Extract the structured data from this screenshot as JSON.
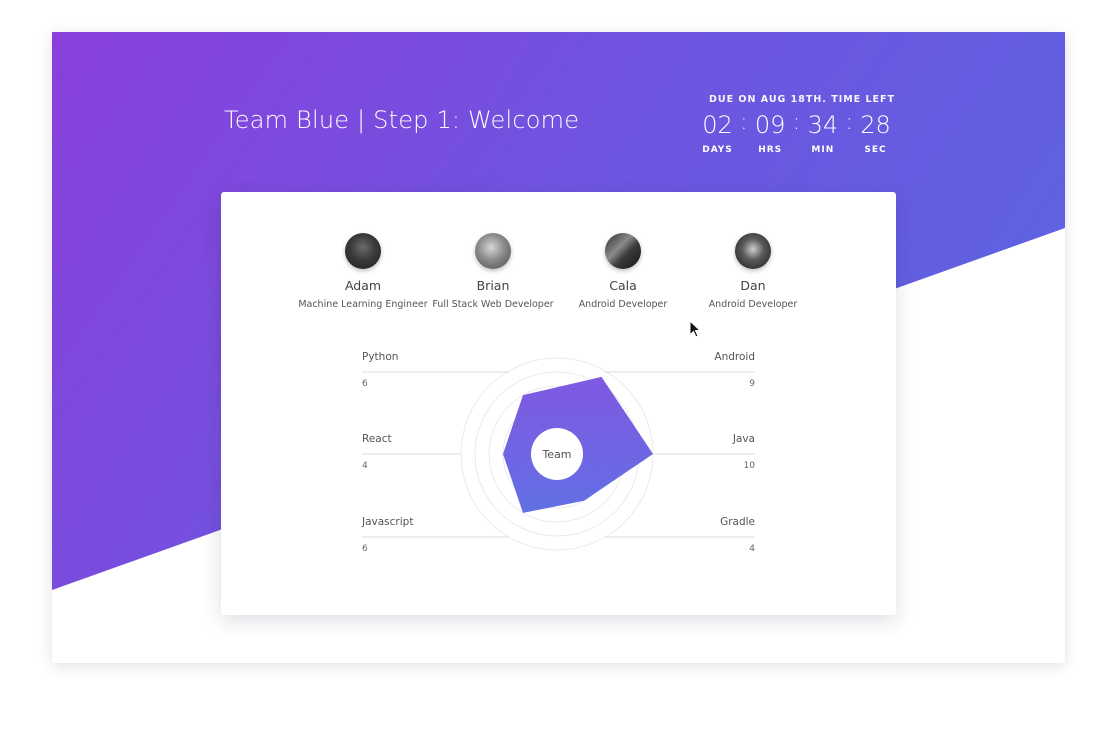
{
  "header": {
    "title": "Team Blue | Step 1: Welcome",
    "due_label": "DUE ON AUG 18TH. TIME LEFT",
    "countdown": [
      {
        "value": "02",
        "label": "DAYS"
      },
      {
        "value": "09",
        "label": "HRS"
      },
      {
        "value": "34",
        "label": "MIN"
      },
      {
        "value": "28",
        "label": "SEC"
      }
    ],
    "separator": ":"
  },
  "team": [
    {
      "name": "Adam",
      "role": "Machine Learning Engineer"
    },
    {
      "name": "Brian",
      "role": "Full Stack Web Developer"
    },
    {
      "name": "Cala",
      "role": "Android Developer"
    },
    {
      "name": "Dan",
      "role": "Android Developer"
    }
  ],
  "colors": {
    "gradient_start": "#8a3fdc",
    "gradient_end": "#566ae2",
    "radar_top": "#7a4fe0",
    "radar_bottom": "#5a68e2"
  },
  "chart_data": {
    "type": "radar",
    "center_label": "Team",
    "scale_max": 10,
    "skills": [
      {
        "label": "Python",
        "value": 6,
        "side": "left"
      },
      {
        "label": "Android",
        "value": 9,
        "side": "right"
      },
      {
        "label": "React",
        "value": 4,
        "side": "left"
      },
      {
        "label": "Java",
        "value": 10,
        "side": "right"
      },
      {
        "label": "Javascript",
        "value": 6,
        "side": "left"
      },
      {
        "label": "Gradle",
        "value": 4,
        "side": "right"
      }
    ]
  }
}
